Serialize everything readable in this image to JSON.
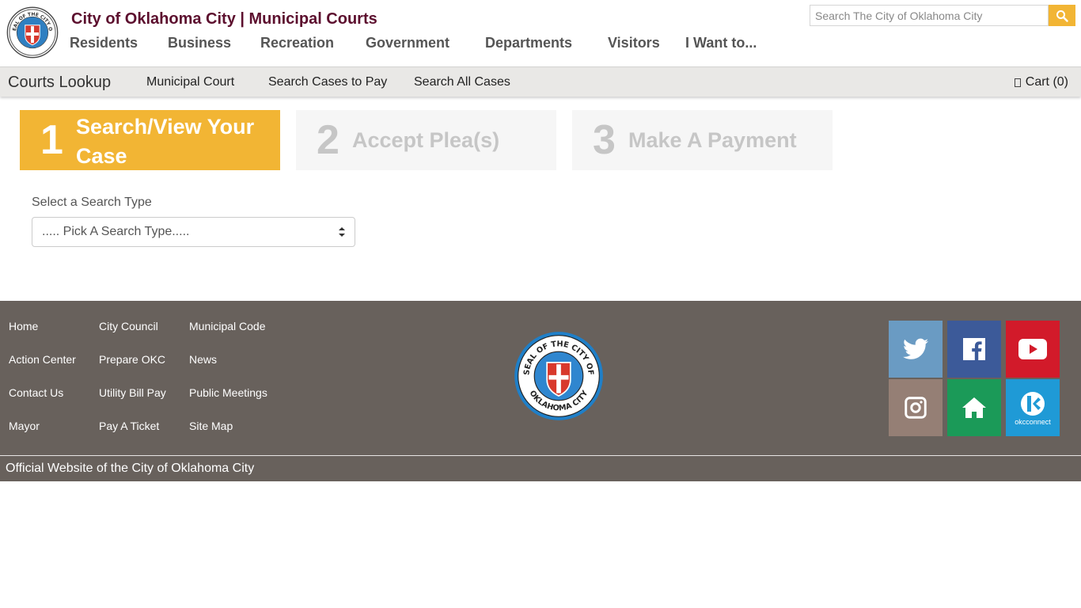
{
  "header": {
    "title": "City of Oklahoma City | Municipal Courts",
    "nav": [
      "Residents",
      "Business",
      "Recreation",
      "Government",
      "Departments",
      "Visitors",
      "I Want to..."
    ],
    "search_placeholder": "Search The City of Oklahoma City"
  },
  "seal": {
    "top_text": "SEAL OF THE CITY OF",
    "bottom_text": "OKLAHOMA CITY"
  },
  "subnav": {
    "brand": "Courts Lookup",
    "links": [
      "Municipal Court",
      "Search Cases to Pay",
      "Search All Cases"
    ],
    "cart": "Cart (0)"
  },
  "steps": [
    {
      "number": "1",
      "label": "Search/View Your Case",
      "active": true
    },
    {
      "number": "2",
      "label": "Accept Plea(s)",
      "active": false
    },
    {
      "number": "3",
      "label": "Make A Payment",
      "active": false
    }
  ],
  "form": {
    "search_type_label": "Select a Search Type",
    "search_type_selected": "..... Pick A Search Type....."
  },
  "footer": {
    "columns": [
      [
        "Home",
        "Action Center",
        "Contact Us",
        "Mayor"
      ],
      [
        "City Council",
        "Prepare OKC",
        "Utility Bill Pay",
        "Pay A Ticket"
      ],
      [
        "Municipal Code",
        "News",
        "Public Meetings",
        "Site Map"
      ]
    ],
    "social": [
      {
        "icon": "twitter-icon",
        "color": "#6a9bc3"
      },
      {
        "icon": "facebook-icon",
        "color": "#3c5a99"
      },
      {
        "icon": "youtube-icon",
        "color": "#d21a2a"
      },
      {
        "icon": "instagram-icon",
        "color": "#957f75"
      },
      {
        "icon": "home-icon",
        "color": "#1b9a58"
      },
      {
        "icon": "okcconnect-icon",
        "color": "#1f9ad6",
        "label": "okcconnect"
      }
    ],
    "official": "Official Website of the City of Oklahoma City"
  },
  "colors": {
    "accent": "#f2b534",
    "title": "#5c0f2e",
    "footer_bg": "#68615c",
    "subnav_bg": "#e9e8e6"
  }
}
